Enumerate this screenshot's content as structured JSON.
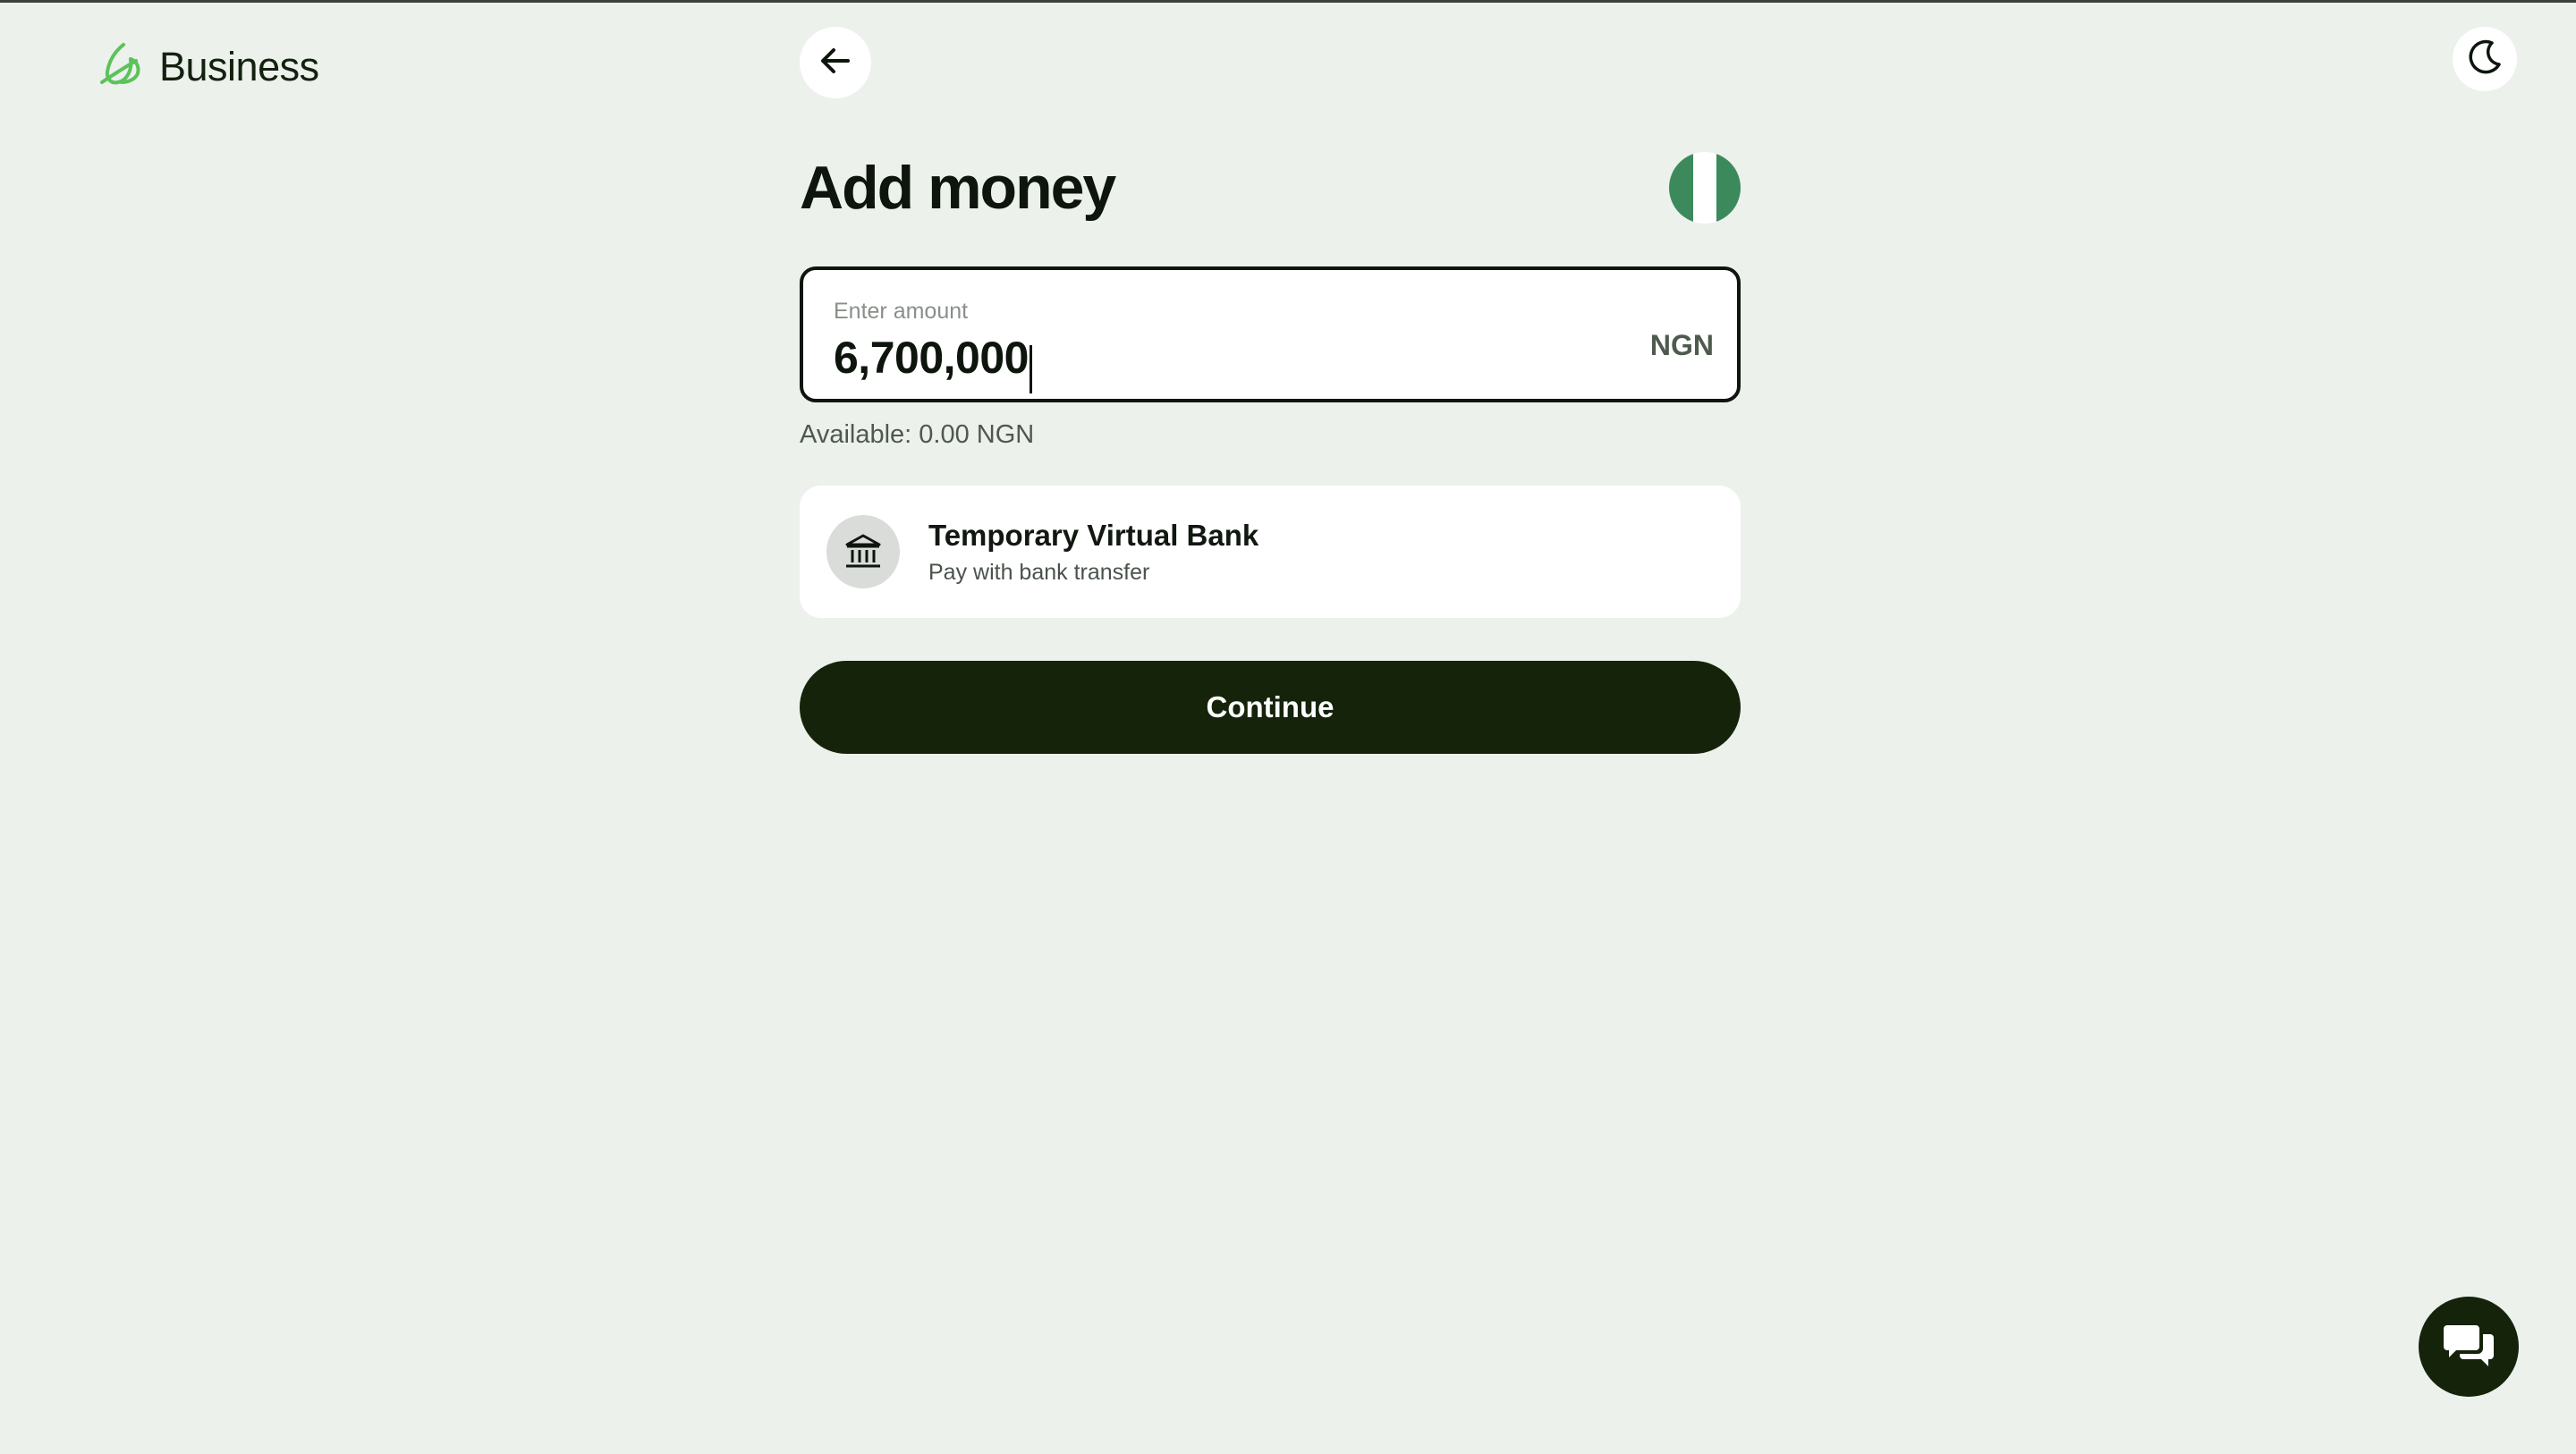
{
  "brand": {
    "name": "Business",
    "icon": "leaf-logo-icon",
    "color": "#5cc25a"
  },
  "header": {
    "back_icon": "arrow-left-icon",
    "theme_icon": "moon-icon"
  },
  "page": {
    "title": "Add money"
  },
  "currency_flag": {
    "country": "Nigeria",
    "colors": [
      "#3c8a5c",
      "#ffffff",
      "#3c8a5c"
    ]
  },
  "amount": {
    "label": "Enter amount",
    "value": "6,700,000",
    "currency": "NGN",
    "available": "Available: 0.00 NGN"
  },
  "payment_method": {
    "icon": "bank-icon",
    "title": "Temporary Virtual Bank",
    "subtitle": "Pay with bank transfer"
  },
  "actions": {
    "continue_label": "Continue"
  },
  "support": {
    "icon": "chat-bubbles-icon"
  },
  "colors": {
    "background": "#ecf1ec",
    "primary_dark": "#14230a",
    "accent_green": "#5cc25a"
  }
}
